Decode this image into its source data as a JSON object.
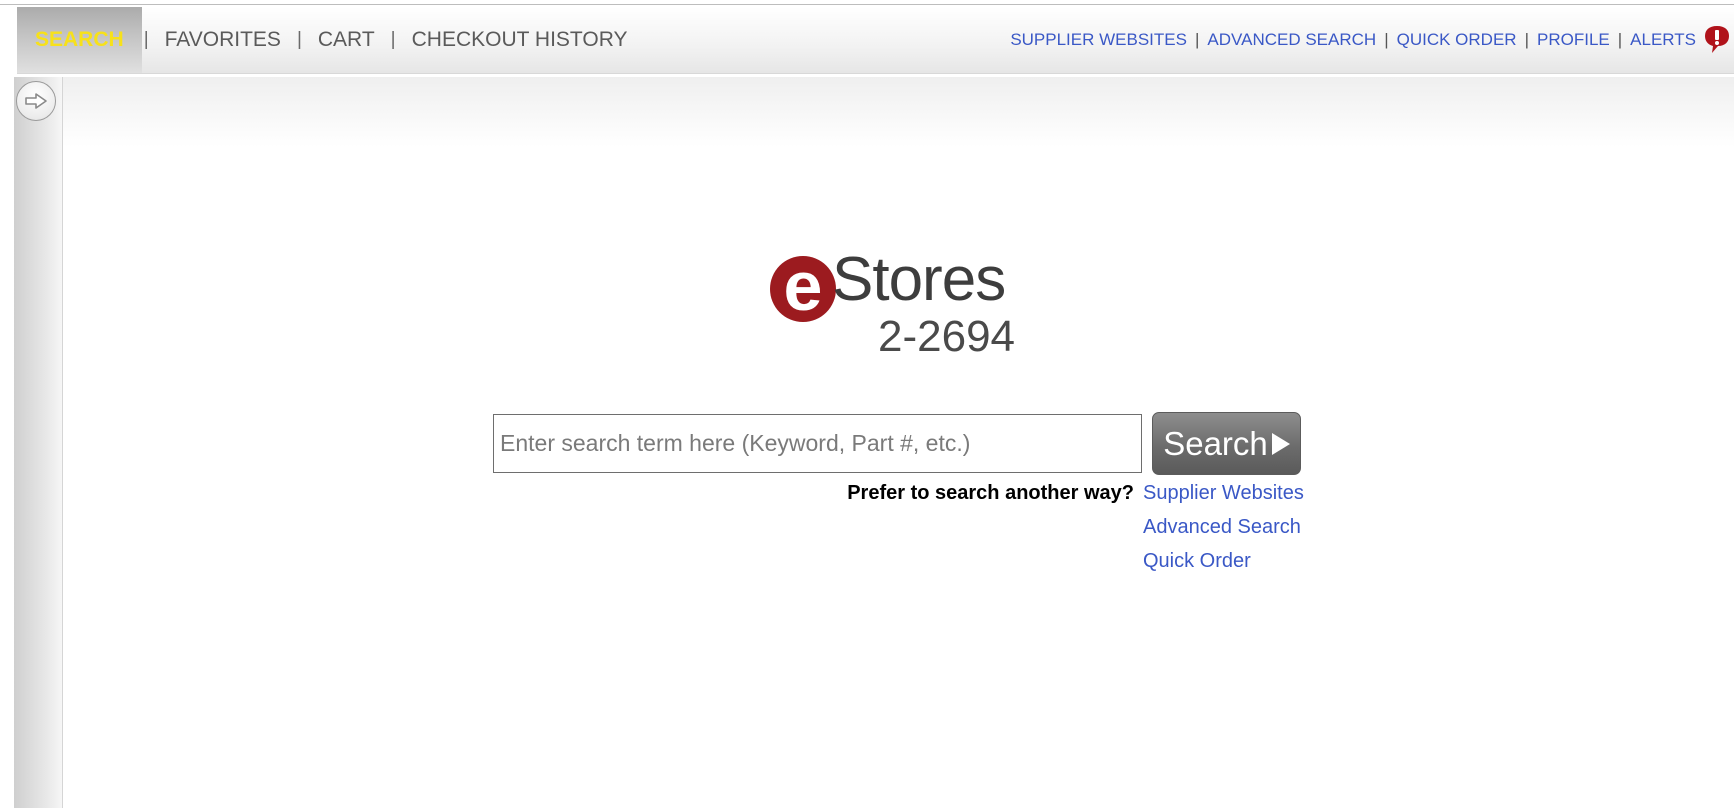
{
  "topbar": {
    "left_tabs": [
      {
        "label": "SEARCH",
        "active": true
      },
      {
        "label": "FAVORITES",
        "active": false
      },
      {
        "label": "CART",
        "active": false
      },
      {
        "label": "CHECKOUT HISTORY",
        "active": false
      }
    ],
    "separator": "|",
    "right_links": [
      {
        "label": "SUPPLIER WEBSITES"
      },
      {
        "label": "ADVANCED SEARCH"
      },
      {
        "label": "QUICK ORDER"
      },
      {
        "label": "PROFILE"
      },
      {
        "label": "ALERTS"
      }
    ],
    "alert_icon": "alert-exclamation-icon"
  },
  "sidebar": {
    "expand_icon": "arrow-right-icon"
  },
  "logo": {
    "letter": "e",
    "word": "Stores",
    "code": "2-2694",
    "brand_color": "#9c1b1f"
  },
  "search": {
    "placeholder": "Enter search term here (Keyword, Part #, etc.)",
    "value": "",
    "button_label": "Search"
  },
  "alternatives": {
    "prompt": "Prefer to search another way?",
    "links": [
      {
        "label": "Supplier Websites"
      },
      {
        "label": "Advanced Search"
      },
      {
        "label": "Quick Order"
      }
    ]
  },
  "colors": {
    "link": "#3a58c6",
    "active_tab_text": "#f7e11a"
  }
}
